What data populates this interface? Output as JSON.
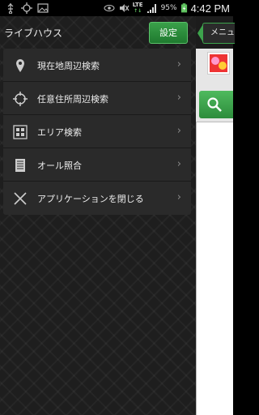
{
  "status_bar": {
    "battery": "95%",
    "network": "LTE",
    "time": "4:42 PM"
  },
  "drawer": {
    "title": "ライブハウス",
    "settings_label": "設定",
    "items": [
      {
        "label": "現在地周辺検索",
        "icon": "location-pin-icon"
      },
      {
        "label": "任意住所周辺検索",
        "icon": "crosshair-icon"
      },
      {
        "label": "エリア検索",
        "icon": "grid-icon"
      },
      {
        "label": "オール照合",
        "icon": "document-icon"
      },
      {
        "label": "アプリケーションを閉じる",
        "icon": "close-icon"
      }
    ]
  },
  "peek": {
    "menu_label": "メニュー"
  },
  "colors": {
    "accent_green": "#2f9a40",
    "drawer_bg": "#1e1e1e",
    "menu_bg": "#2a2a2a"
  }
}
